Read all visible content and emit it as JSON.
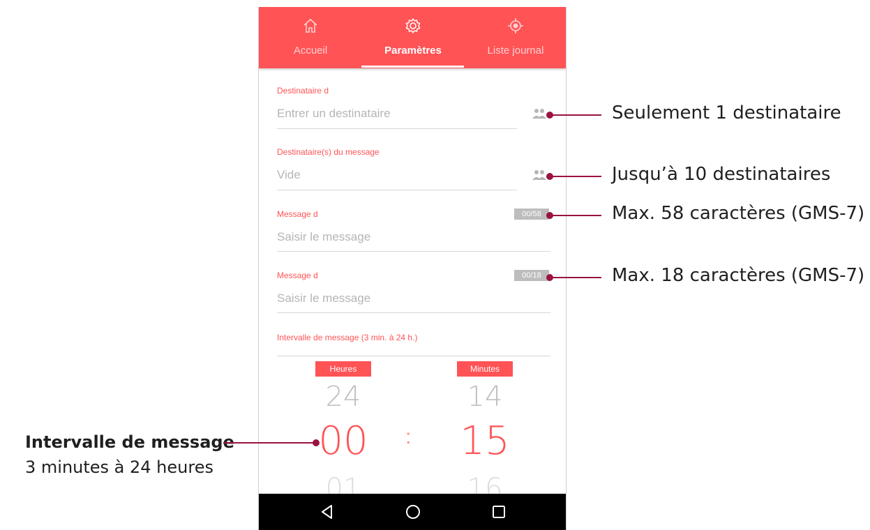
{
  "tabs": [
    {
      "label": "Accueil",
      "icon": "home-icon",
      "active": false
    },
    {
      "label": "Paramètres",
      "icon": "gear-icon",
      "active": true
    },
    {
      "label": "Liste journal",
      "icon": "location-target-icon",
      "active": false
    }
  ],
  "fields": {
    "recipient": {
      "label": "Destinataire d",
      "placeholder": "Entrer un destinataire"
    },
    "message_recipients": {
      "label": "Destinataire(s) du message",
      "value": "Vide"
    },
    "message_1": {
      "label": "Message d",
      "placeholder": "Saisir le message",
      "counter": "00/58"
    },
    "message_2": {
      "label": "Message d",
      "placeholder": "Saisir le message",
      "counter": "00/18"
    },
    "interval": {
      "label": "Intervalle de message (3 min. à 24 h.)"
    }
  },
  "picker": {
    "hours_label": "Heures",
    "minutes_label": "Minutes",
    "hours_prev": "24",
    "hours_current": "00",
    "hours_next": "01",
    "minutes_prev": "14",
    "minutes_current": "15",
    "minutes_next": "16",
    "separator": ":"
  },
  "callouts": {
    "recipient": "Seulement 1 destinataire",
    "recipients": "Jusqu’à 10 destinataires",
    "message_1": "Max. 58 caractères (GMS-7)",
    "message_2": "Max. 18 caractères (GMS-7)",
    "interval_title": "Intervalle de message",
    "interval_sub": "3 minutes à 24 heures"
  },
  "colors": {
    "accent": "#ff5356",
    "callout": "#9a1240",
    "nav": "#000000"
  }
}
